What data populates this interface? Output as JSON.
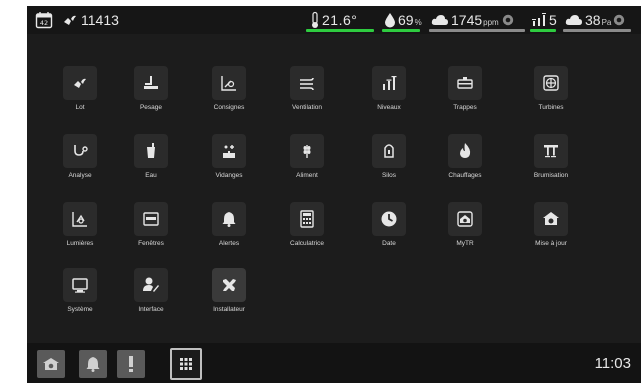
{
  "status": {
    "calendar_day": "42",
    "count": "11413",
    "temperature": "21.6°",
    "humidity": "69",
    "humidity_unit": "%",
    "co2": "1745",
    "co2_unit": "ppm",
    "level": "5",
    "pressure": "38",
    "pressure_unit": "Pa"
  },
  "colors": {
    "good": "#2ecc40",
    "neutral": "#8a8a8a"
  },
  "menu": [
    {
      "label": "Lot",
      "icon": "chick-icon"
    },
    {
      "label": "Pesage",
      "icon": "scale-icon"
    },
    {
      "label": "Consignes",
      "icon": "setpoint-chart-icon"
    },
    {
      "label": "Ventilation",
      "icon": "fan-airflow-icon"
    },
    {
      "label": "Niveaux",
      "icon": "levels-icon"
    },
    {
      "label": "Trappes",
      "icon": "hatch-icon"
    },
    {
      "label": "Turbines",
      "icon": "turbine-icon"
    },
    {
      "label": "Analyse",
      "icon": "stethoscope-icon"
    },
    {
      "label": "Eau",
      "icon": "water-glass-icon"
    },
    {
      "label": "Vidanges",
      "icon": "drain-icon"
    },
    {
      "label": "Aliment",
      "icon": "grain-icon"
    },
    {
      "label": "Silos",
      "icon": "silo-icon"
    },
    {
      "label": "Chauffages",
      "icon": "flame-icon"
    },
    {
      "label": "Brumisation",
      "icon": "mist-icon"
    },
    {
      "label": "Lumières",
      "icon": "light-chart-icon"
    },
    {
      "label": "Fenêtres",
      "icon": "window-icon"
    },
    {
      "label": "Alertes",
      "icon": "bell-icon"
    },
    {
      "label": "Calculatrice",
      "icon": "calculator-icon"
    },
    {
      "label": "Date",
      "icon": "clock-icon"
    },
    {
      "label": "MyTR",
      "icon": "mytr-icon"
    },
    {
      "label": "Mise à jour",
      "icon": "update-icon"
    },
    {
      "label": "Système",
      "icon": "monitor-icon"
    },
    {
      "label": "Interface",
      "icon": "user-edit-icon"
    },
    {
      "label": "Installateur",
      "icon": "tools-icon"
    }
  ],
  "bottombar": {
    "time": "11:03"
  }
}
